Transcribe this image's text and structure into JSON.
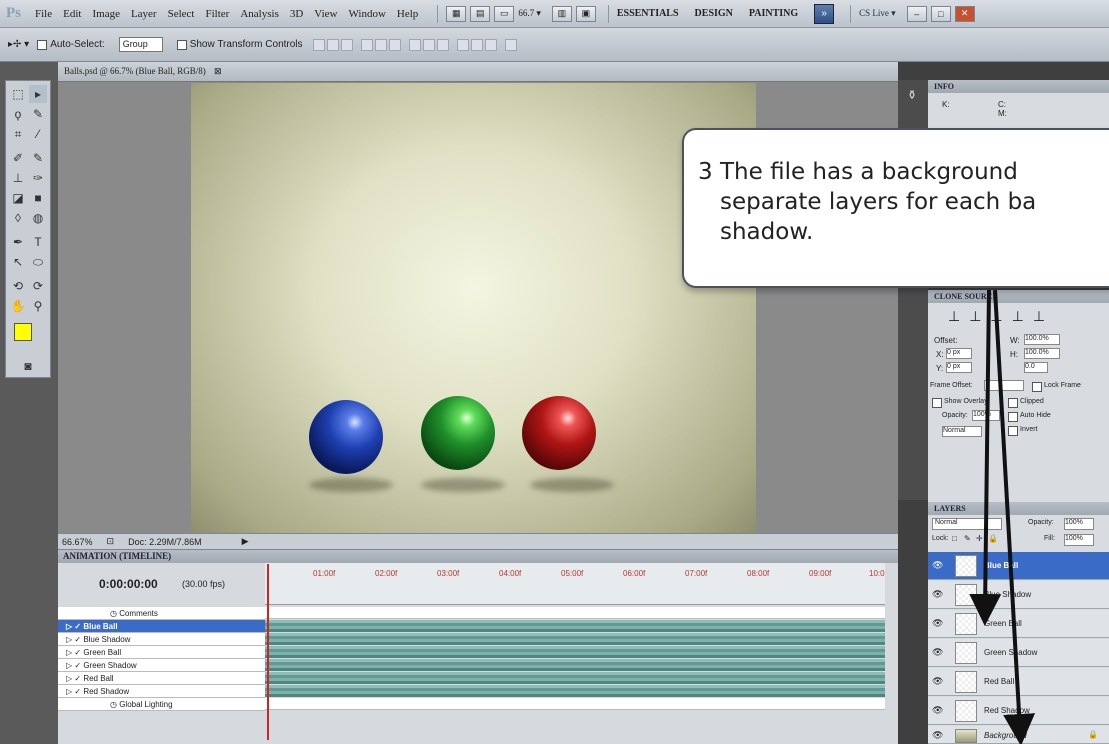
{
  "app": {
    "logo": "Ps"
  },
  "menu": [
    "File",
    "Edit",
    "Image",
    "Layer",
    "Select",
    "Filter",
    "Analysis",
    "3D",
    "View",
    "Window",
    "Help"
  ],
  "zoom_menu": "66.7 ▾",
  "workspaces": [
    "ESSENTIALS",
    "DESIGN",
    "PAINTING"
  ],
  "cslive": "CS Live ▾",
  "options": {
    "auto_select": "Auto-Select:",
    "group": "Group",
    "show_transform": "Show Transform Controls"
  },
  "document": {
    "tab_title": "Balls.psd @ 66.7% (Blue Ball, RGB/8)",
    "close": "⊠",
    "status_zoom": "66.67%",
    "status_doc": "Doc: 2.29M/7.86M"
  },
  "timeline": {
    "title": "ANIMATION (TIMELINE)",
    "timecode": "0:00:00:00",
    "fps": "(30.00 fps)",
    "ticks": [
      "01:00f",
      "02:00f",
      "03:00f",
      "04:00f",
      "05:00f",
      "06:00f",
      "07:00f",
      "08:00f",
      "09:00f",
      "10:0"
    ],
    "rows": [
      {
        "label": "Comments",
        "type": "plain"
      },
      {
        "label": "Blue Ball",
        "type": "layer",
        "selected": true
      },
      {
        "label": "Blue Shadow",
        "type": "layer"
      },
      {
        "label": "Green Ball",
        "type": "layer"
      },
      {
        "label": "Green Shadow",
        "type": "layer"
      },
      {
        "label": "Red Ball",
        "type": "layer"
      },
      {
        "label": "Red Shadow",
        "type": "layer"
      },
      {
        "label": "Global Lighting",
        "type": "plain"
      }
    ]
  },
  "info_panel": {
    "title": "INFO",
    "k": "K:",
    "c": "C:",
    "m": "M:"
  },
  "clone_panel": {
    "title": "CLONE SOURCE",
    "offset": "Offset:",
    "x": "X:",
    "y": "Y:",
    "w": "W:",
    "h": "H:",
    "px": "0 px",
    "w_val": "100.0%",
    "h_val": "100.0%",
    "angle": "0.0",
    "frame_offset": "Frame Offset:",
    "lock_frame": "Lock Frame",
    "show_overlay": "Show Overlay",
    "clipped": "Clipped",
    "opacity": "Opacity:",
    "opacity_val": "100%",
    "auto_hide": "Auto Hide",
    "normal": "Normal",
    "invert": "Invert"
  },
  "layers_panel": {
    "title": "LAYERS",
    "blend": "Normal",
    "opacity": "Opacity:",
    "opacity_val": "100%",
    "lock": "Lock:",
    "fill": "Fill:",
    "fill_val": "100%",
    "layers": [
      "Blue Ball",
      "Blue Shadow",
      "Green Ball",
      "Green Shadow",
      "Red Ball",
      "Red Shadow",
      "Background"
    ]
  },
  "callout": {
    "number": "3",
    "line1": "The file has a background",
    "line2": "separate layers for each ba",
    "line3": "shadow."
  },
  "colors": {
    "accent_blue": "#3a6cc7",
    "ball_blue": "#1e3fb0",
    "ball_green": "#1f8f2a",
    "ball_red": "#b01515",
    "foreground": "#ffff00"
  }
}
